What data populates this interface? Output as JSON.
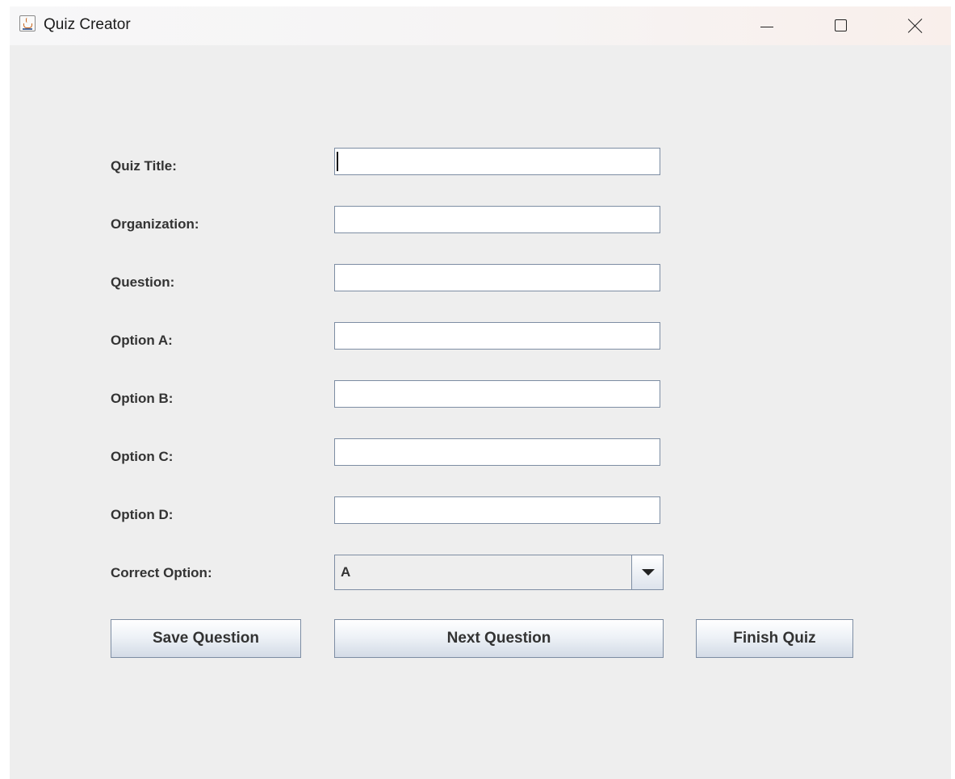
{
  "window": {
    "title": "Quiz Creator",
    "controls": {
      "minimize": "minimize",
      "maximize": "maximize",
      "close": "close"
    }
  },
  "form": {
    "quiz_title": {
      "label": "Quiz Title:",
      "value": ""
    },
    "organization": {
      "label": "Organization:",
      "value": ""
    },
    "question": {
      "label": "Question:",
      "value": ""
    },
    "option_a": {
      "label": "Option A:",
      "value": ""
    },
    "option_b": {
      "label": "Option B:",
      "value": ""
    },
    "option_c": {
      "label": "Option C:",
      "value": ""
    },
    "option_d": {
      "label": "Option D:",
      "value": ""
    },
    "correct_option": {
      "label": "Correct Option:",
      "selected": "A"
    }
  },
  "buttons": {
    "save": "Save Question",
    "next": "Next Question",
    "finish": "Finish Quiz"
  },
  "icons": {
    "app": "java-coffee-cup-icon",
    "combo_arrow": "chevron-down-icon"
  }
}
